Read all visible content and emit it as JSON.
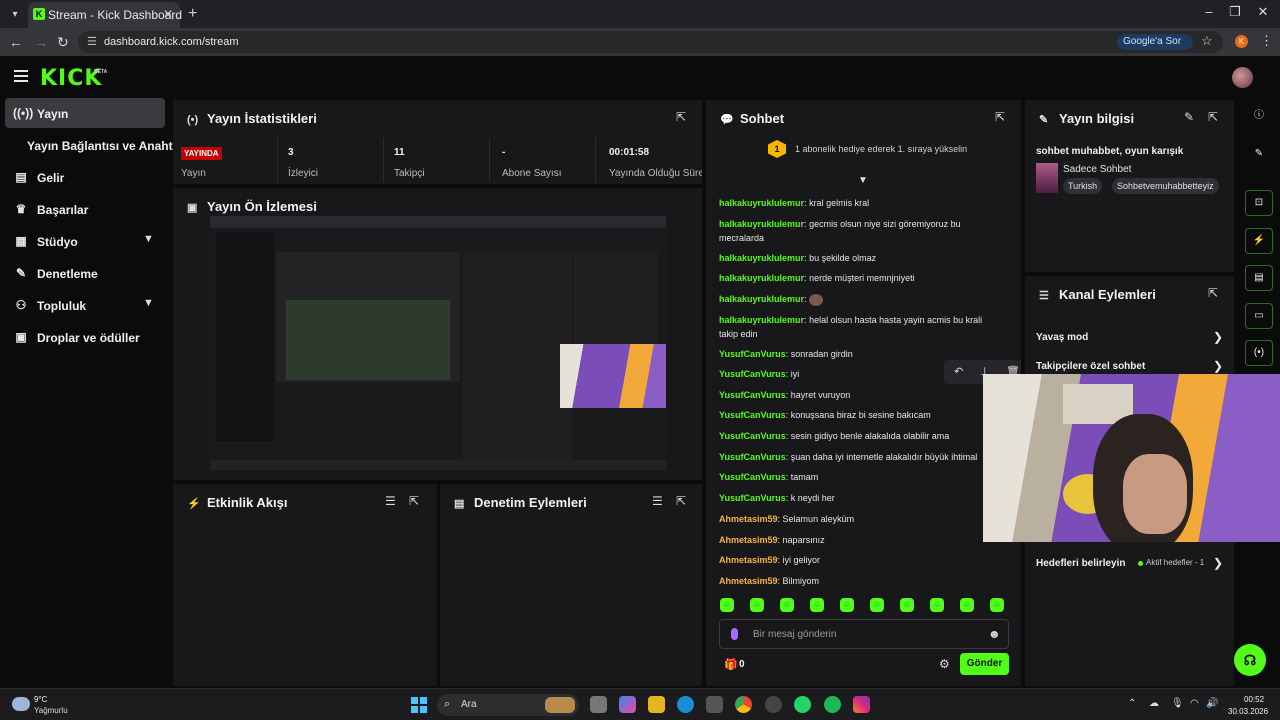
{
  "browser": {
    "tab_title": "Stream - Kick Dashboard",
    "url": "dashboard.kick.com/stream",
    "google_ask": "Google'a Sor",
    "profile_letter": "K"
  },
  "header": {
    "logo": "KICK",
    "beta": "BETA"
  },
  "sidebar": {
    "items": [
      {
        "label": "Yayın",
        "icon": "broadcast-icon"
      },
      {
        "label": "Yayın Bağlantısı ve Anahtarı"
      },
      {
        "label": "Gelir",
        "icon": "wallet-icon"
      },
      {
        "label": "Başarılar",
        "icon": "trophy-icon"
      },
      {
        "label": "Stüdyo",
        "icon": "studio-icon"
      },
      {
        "label": "Denetleme",
        "icon": "wrench-icon"
      },
      {
        "label": "Topluluk",
        "icon": "people-icon"
      },
      {
        "label": "Droplar ve ödüller",
        "icon": "gift-icon"
      }
    ]
  },
  "stats": {
    "title": "Yayın İstatistikleri",
    "live_badge": "YAYINDA",
    "items": [
      {
        "value": "",
        "label": "Yayın"
      },
      {
        "value": "3",
        "label": "İzleyici"
      },
      {
        "value": "11",
        "label": "Takipçi"
      },
      {
        "value": "-",
        "label": "Abone Sayısı"
      },
      {
        "value": "00:01:58",
        "label": "Yayında Olduğu Süre"
      }
    ]
  },
  "preview": {
    "title": "Yayın Ön İzlemesi"
  },
  "activity": {
    "title": "Etkinlik Akışı"
  },
  "moderation": {
    "title": "Denetim Eylemleri"
  },
  "chat": {
    "title": "Sohbet",
    "banner_rank": "1",
    "banner": "1 abonelik hediye ederek 1. sıraya yükselin",
    "messages": [
      {
        "user": "halkakuyruklulemur",
        "text": "kral gelmis kral",
        "color": "#53fc18"
      },
      {
        "user": "halkakuyruklulemur",
        "text": "gecmis olsun niye sizi göremiyoruz bu mecralarda",
        "color": "#53fc18"
      },
      {
        "user": "halkakuyruklulemur",
        "text": "bu şekilde olmaz",
        "color": "#53fc18"
      },
      {
        "user": "halkakuyruklulemur",
        "text": "nerde müşteri memnjniyeti",
        "color": "#53fc18"
      },
      {
        "user": "halkakuyruklulemur",
        "text": "",
        "color": "#53fc18"
      },
      {
        "user": "halkakuyruklulemur",
        "text": "helal olsun hasta hasta yayin acmis bu krali takip edin",
        "color": "#53fc18"
      },
      {
        "user": "YusufCanVurus",
        "text": "sonradan girdin",
        "color": "#53fc18"
      },
      {
        "user": "YusufCanVurus",
        "text": "iyi",
        "color": "#53fc18"
      },
      {
        "user": "YusufCanVurus",
        "text": "hayret vuruyon",
        "color": "#53fc18"
      },
      {
        "user": "YusufCanVurus",
        "text": "konuşsana biraz bi sesine bakıcam",
        "color": "#53fc18"
      },
      {
        "user": "YusufCanVurus",
        "text": "sesin gidiyo benle alakalıda olabilir ama",
        "color": "#53fc18"
      },
      {
        "user": "YusufCanVurus",
        "text": "şuan daha iyi internetle alakalıdır büyük ihtimal",
        "color": "#53fc18"
      },
      {
        "user": "YusufCanVurus",
        "text": "tamam",
        "color": "#53fc18"
      },
      {
        "user": "YusufCanVurus",
        "text": "k neydi her",
        "color": "#53fc18"
      },
      {
        "user": "Ahmetasim59",
        "text": "Selamun aleyküm",
        "color": "#f5b342"
      },
      {
        "user": "Ahmetasim59",
        "text": "naparsınız",
        "color": "#f5b342"
      },
      {
        "user": "Ahmetasim59",
        "text": "iyi geliyor",
        "color": "#f5b342"
      },
      {
        "user": "Ahmetasim59",
        "text": "Bilmiyom",
        "color": "#f5b342"
      }
    ],
    "input_placeholder": "Bir mesaj gönderin",
    "gift_count": "0",
    "send_label": "Gönder"
  },
  "stream_info": {
    "title": "Yayın bilgisi",
    "stream_title": "sohbet muhabbet, oyun karışık",
    "category": "Sadece Sohbet",
    "tags": [
      "Turkish",
      "Sohbetvemuhabbetteyiz"
    ]
  },
  "channel_actions": {
    "title": "Kanal Eylemleri",
    "items": [
      "Yavaş mod",
      "Takipçilere özel sohbet"
    ],
    "goals_label": "Hedefleri belirleyin",
    "goals_status": "Aktif hedefler - 1"
  },
  "taskbar": {
    "temp": "9°C",
    "weather": "Yağmurlu",
    "search": "Ara",
    "time": "00:52",
    "date": "30.03.2026"
  },
  "colors": {
    "accent": "#53fc18",
    "live": "#c40000",
    "panel": "#18181b",
    "bg": "#0b0b0c"
  }
}
